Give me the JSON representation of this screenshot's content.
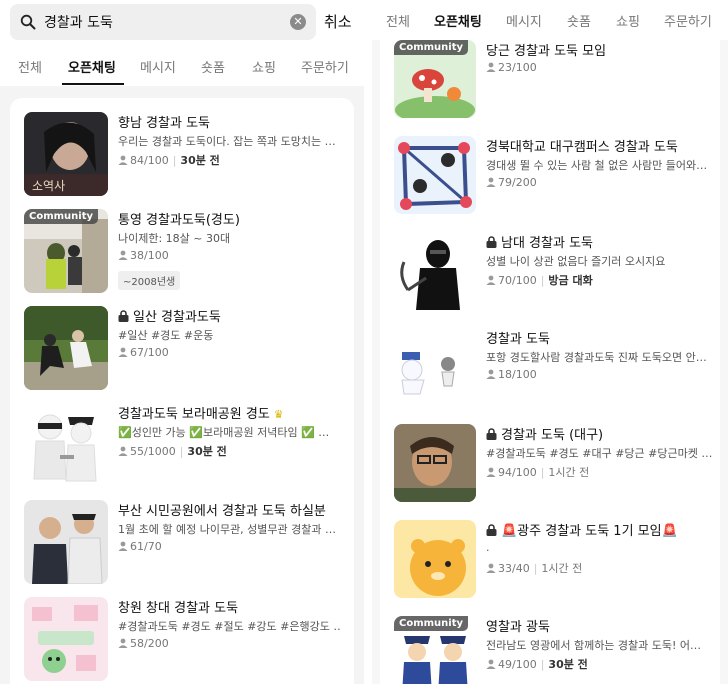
{
  "search": {
    "query": "경찰과 도둑",
    "cancel_label": "취소"
  },
  "left_tabs": [
    "전체",
    "오픈채팅",
    "메시지",
    "숏폼",
    "쇼핑",
    "주문하기"
  ],
  "right_tabs": [
    "전체",
    "오픈채팅",
    "메시지",
    "숏폼",
    "쇼핑",
    "주문하기"
  ],
  "community_badge": "Community",
  "left_results": [
    {
      "title": "향남 경찰과 도둑",
      "desc": "우리는 경찰과 도둑이다. 잡는 쪽과 도망치는 …",
      "members": "84/100",
      "time": "30분 전"
    },
    {
      "title": "통영 경찰과도둑(경도)",
      "desc": "나이제한: 18살 ~ 30대",
      "members": "38/100",
      "tag": "~2008년생"
    },
    {
      "title": "일산 경찰과도둑",
      "desc": "#일산 #경도 #운동",
      "members": "67/100"
    },
    {
      "title": "경찰과도둑 보라매공원 경도",
      "desc": "✅성인만 가능 ✅보라매공원 저녁타임 ✅ …",
      "members": "55/1000",
      "time": "30분 전"
    },
    {
      "title": "부산 시민공원에서 경찰과 도둑 하실분",
      "desc": "1월 초에 할 예정 나이무관, 성별무관 경찰과 …",
      "members": "61/70"
    },
    {
      "title": "창원 창대 경찰과 도둑",
      "desc": "#경찰과도둑 #경도 #절도 #강도 #은행강도 …",
      "members": "58/200"
    }
  ],
  "right_results": [
    {
      "title": "당근 경찰과 도둑 모임",
      "desc": "",
      "members": "23/100"
    },
    {
      "title": "경북대학교 대구캠퍼스 경찰과 도둑",
      "desc": "경대생 뛸 수 있는 사람 철 없은 사람만 들어와…",
      "members": "79/200"
    },
    {
      "title": "남대 경찰과 도둑",
      "desc": "성별 나이 상관 없음다 즐기러 오시지요",
      "members": "70/100",
      "time": "방금 대화"
    },
    {
      "title": "경찰과 도둑",
      "desc": "포항 경도할사람 경찰과도둑 진짜 도둑오면 안…",
      "members": "18/100"
    },
    {
      "title": "경찰과 도둑 (대구)",
      "desc": "#경찰과도둑 #경도 #대구 #당근 #당근마켓 …",
      "members": "94/100",
      "time": "1시간 전"
    },
    {
      "title": "🚨광주 경찰과 도둑 1기 모임🚨",
      "desc": ".",
      "members": "33/40",
      "time": "1시간 전"
    },
    {
      "title": "영찰과 광둑",
      "desc": "전라남도 영광에서 함께하는 경찰과 도둑! 어…",
      "members": "49/100",
      "time": "30분 전"
    }
  ]
}
